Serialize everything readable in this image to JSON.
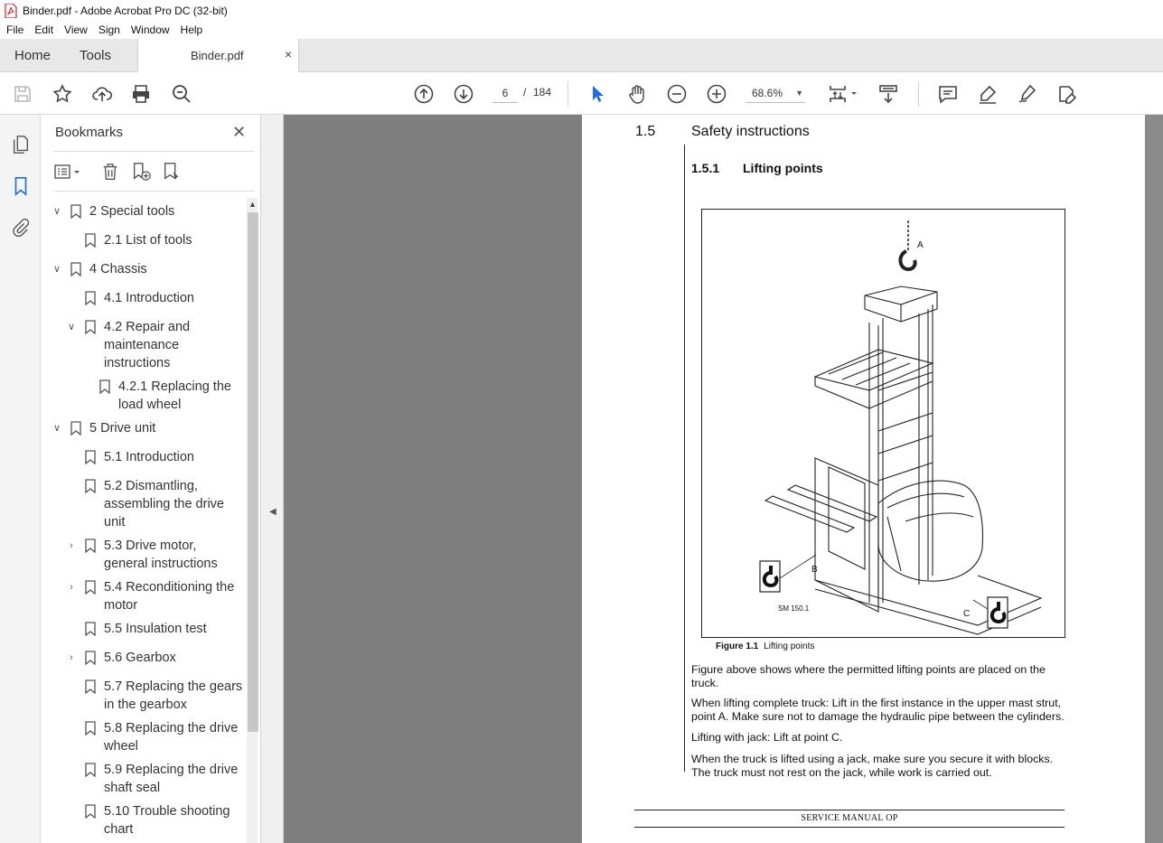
{
  "window": {
    "title": "Binder.pdf - Adobe Acrobat Pro DC (32-bit)"
  },
  "menu": [
    "File",
    "Edit",
    "View",
    "Sign",
    "Window",
    "Help"
  ],
  "tabs": {
    "home": "Home",
    "tools": "Tools",
    "document": "Binder.pdf",
    "close": "×"
  },
  "toolbar": {
    "page_current": "6",
    "page_separator": "/",
    "page_total": "184",
    "zoom": "68.6%"
  },
  "bookmarks": {
    "header": "Bookmarks",
    "close": "✕",
    "items": [
      {
        "label": "2 Special tools",
        "expanded": "open"
      },
      {
        "label": "2.1 List of tools"
      },
      {
        "label": "4 Chassis",
        "expanded": "open"
      },
      {
        "label": "4.1 Introduction"
      },
      {
        "label": "4.2 Repair and maintenance instructions",
        "expanded": "open"
      },
      {
        "label": "4.2.1 Replacing the load wheel"
      },
      {
        "label": "5 Drive unit",
        "expanded": "open"
      },
      {
        "label": "5.1 Introduction"
      },
      {
        "label": "5.2 Dismantling, assembling the drive unit"
      },
      {
        "label": "5.3 Drive motor, general instructions",
        "expanded": "closed"
      },
      {
        "label": "5.4 Reconditioning the motor",
        "expanded": "closed"
      },
      {
        "label": "5.5 Insulation test"
      },
      {
        "label": "5.6 Gearbox",
        "expanded": "closed"
      },
      {
        "label": "5.7 Replacing the gears in the gearbox"
      },
      {
        "label": "5.8 Replacing the drive wheel"
      },
      {
        "label": "5.9 Replacing the drive shaft seal"
      },
      {
        "label": "5.10 Trouble shooting chart"
      }
    ]
  },
  "document": {
    "section_number": "1.5",
    "section_title": "Safety instructions",
    "subsection_number": "1.5.1",
    "subsection_title": "Lifting points",
    "figure": {
      "label_a": "A",
      "label_b": "B",
      "label_c": "C",
      "code": "SM 150.1",
      "caption_number": "Figure 1.1",
      "caption_text": "Lifting points"
    },
    "paragraphs": [
      "Figure above shows where the permitted lifting points are placed on the truck.",
      "When lifting complete truck: Lift in the first instance in the upper mast strut, point A. Make sure not to damage the hydraulic pipe between the cylinders.",
      "Lifting with jack: Lift at point C.",
      "When the truck is lifted using a jack, make sure you secure it with blocks. The truck must not rest on the jack, while work is carried out."
    ],
    "footer": "SERVICE MANUAL OP"
  }
}
